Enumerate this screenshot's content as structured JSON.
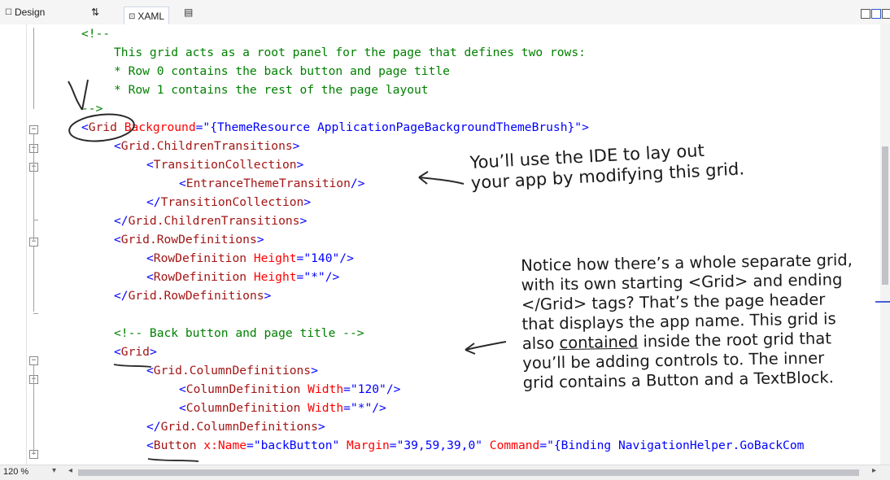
{
  "tabs": {
    "design": "Design",
    "swap": "⇅",
    "xaml": "XAML"
  },
  "code_lines": {
    "l0": "<!--",
    "l1": "This grid acts as a root panel for the page that defines two rows:",
    "l2": "* Row 0 contains the back button and page title",
    "l3": "* Row 1 contains the rest of the page layout",
    "l4": "-->",
    "l5": {
      "o": "<",
      "n": "Grid",
      "a": " Background",
      "eq": "=",
      "v": "\"{ThemeResource ApplicationPageBackgroundThemeBrush}\"",
      "c": ">"
    },
    "l6": {
      "o": "<",
      "n": "Grid.ChildrenTransitions",
      "c": ">"
    },
    "l7": {
      "o": "<",
      "n": "TransitionCollection",
      "c": ">"
    },
    "l8": {
      "o": "<",
      "n": "EntranceThemeTransition",
      "c": "/>"
    },
    "l9": {
      "o": "</",
      "n": "TransitionCollection",
      "c": ">"
    },
    "l10": {
      "o": "</",
      "n": "Grid.ChildrenTransitions",
      "c": ">"
    },
    "l11": {
      "o": "<",
      "n": "Grid.RowDefinitions",
      "c": ">"
    },
    "l12": {
      "o": "<",
      "n": "RowDefinition",
      "a": " Height",
      "eq": "=",
      "v": "\"140\"",
      "c": "/>"
    },
    "l13": {
      "o": "<",
      "n": "RowDefinition",
      "a": " Height",
      "eq": "=",
      "v": "\"*\"",
      "c": "/>"
    },
    "l14": {
      "o": "</",
      "n": "Grid.RowDefinitions",
      "c": ">"
    },
    "l16": "<!-- Back button and page title -->",
    "l17": {
      "o": "<",
      "n": "Grid",
      "c": ">"
    },
    "l18": {
      "o": "<",
      "n": "Grid.ColumnDefinitions",
      "c": ">"
    },
    "l19": {
      "o": "<",
      "n": "ColumnDefinition",
      "a": " Width",
      "eq": "=",
      "v": "\"120\"",
      "c": "/>"
    },
    "l20": {
      "o": "<",
      "n": "ColumnDefinition",
      "a": " Width",
      "eq": "=",
      "v": "\"*\"",
      "c": "/>"
    },
    "l21": {
      "o": "</",
      "n": "Grid.ColumnDefinitions",
      "c": ">"
    },
    "l22": {
      "o": "<",
      "n": "Button",
      "a1": " x:Name",
      "eq1": "=",
      "v1": "\"backButton\"",
      "a2": " Margin",
      "eq2": "=",
      "v2": "\"39,59,39,0\"",
      "a3": " Command",
      "eq3": "=",
      "v3": "\"{Binding NavigationHelper.GoBackCom"
    }
  },
  "annotations": {
    "note1": [
      "You’ll use the IDE to lay out",
      "your app by modifying this grid."
    ],
    "note2": [
      "Notice how there’s a whole separate grid,",
      "with its own starting <Grid> and ending",
      "</Grid> tags? That’s the page header",
      "that displays the app name. This grid is",
      "also",
      "contained",
      "inside the root grid that",
      "you’ll be adding controls to. The inner",
      "grid contains a Button and a TextBlock."
    ]
  },
  "status": {
    "zoom": "120 %"
  },
  "colors": {
    "comment": "#008000",
    "bracket": "#0000ff",
    "element": "#a31515",
    "attribute": "#ff0000",
    "value": "#0000ff"
  },
  "icons": [
    "design-icon",
    "swap-panes-icon",
    "xaml-icon",
    "split-view-icon",
    "fold-minus-icon",
    "chevron-down-icon",
    "arrow-left-icon",
    "arrow-right-icon"
  ]
}
